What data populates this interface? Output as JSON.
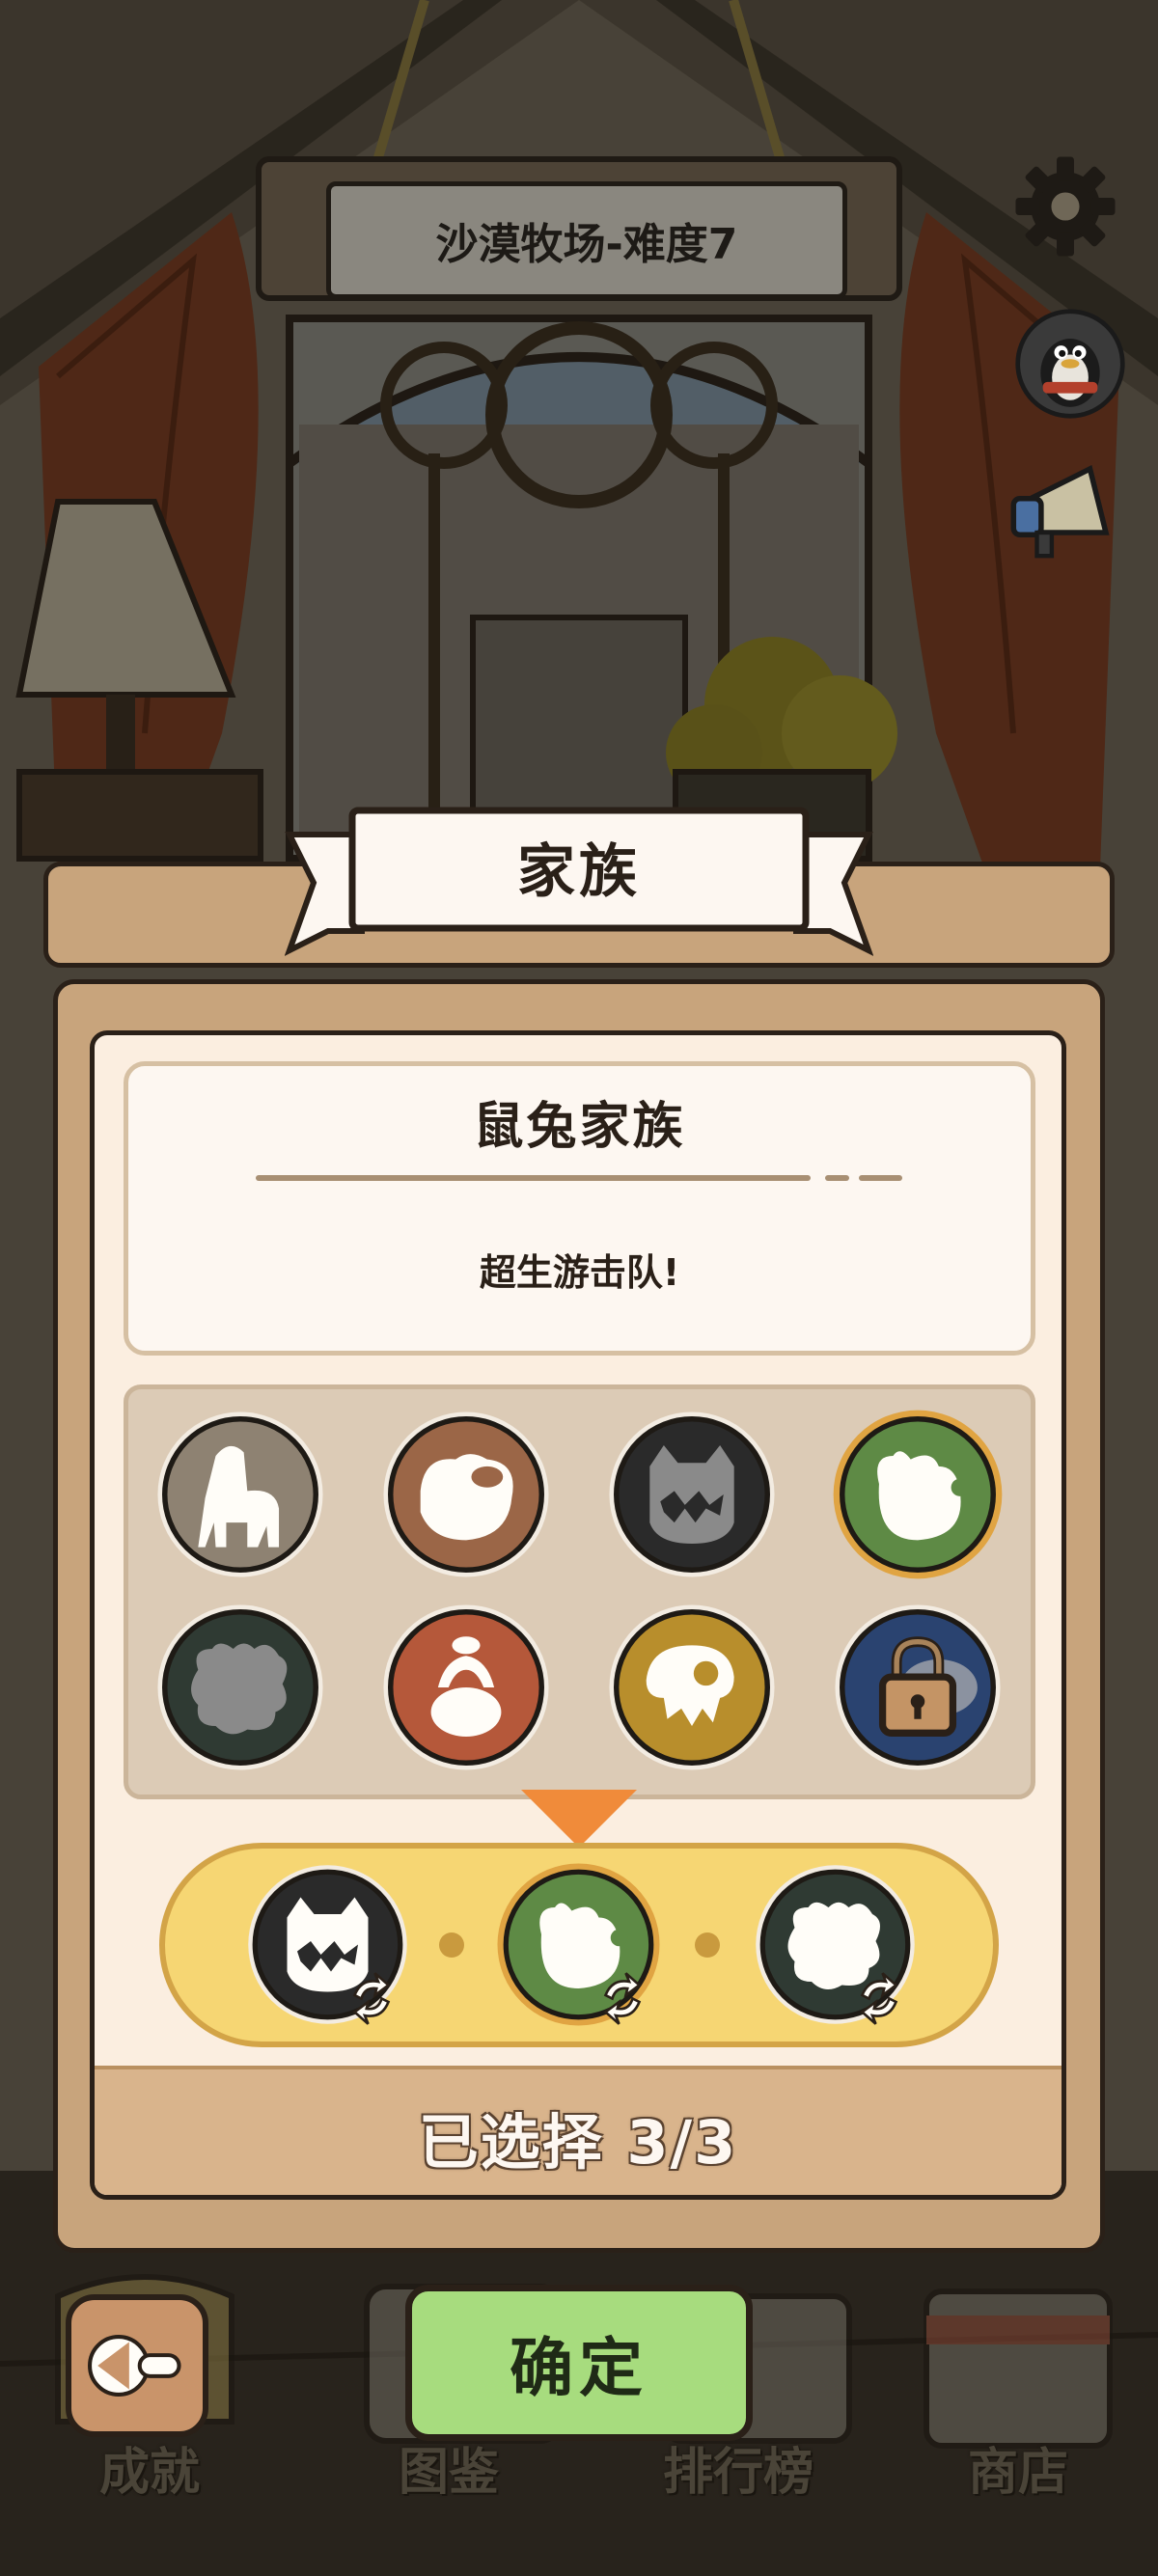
{
  "header": {
    "level_title": "沙漠牧场-难度7"
  },
  "dialog": {
    "title": "家族",
    "family_name": "鼠兔家族",
    "family_desc": "超生游击队!",
    "selected_label": "已选择 3/3",
    "confirm_label": "确定"
  },
  "families": [
    {
      "icon": "llama-family-icon",
      "color": "#8e8272",
      "selected": false
    },
    {
      "icon": "bird-family-icon",
      "color": "#9b6647",
      "selected": false
    },
    {
      "icon": "cat-family-icon",
      "color": "#2a2a2a",
      "selected": false
    },
    {
      "icon": "pika-family-icon",
      "color": "#5e8a45",
      "selected": true
    },
    {
      "icon": "mouse-family-icon",
      "color": "#2f3a33",
      "selected": false
    },
    {
      "icon": "bag-family-icon",
      "color": "#b5583a",
      "selected": false
    },
    {
      "icon": "fossil-family-icon",
      "color": "#b88e2c",
      "selected": false
    },
    {
      "icon": "locked-family-icon",
      "color": "#2a4370",
      "selected": false
    }
  ],
  "selected_slots": [
    {
      "icon": "cat-family-icon"
    },
    {
      "icon": "pika-family-icon"
    },
    {
      "icon": "mouse-family-icon"
    }
  ],
  "nav": {
    "achievements": "成就",
    "collection": "图鉴",
    "leaderboard": "排行榜",
    "shop": "商店"
  },
  "colors": {
    "panel": "#c8a47c",
    "panel_inner": "#fbeee0",
    "selected_bar": "#f6d673",
    "confirm": "#a7dc7e"
  }
}
